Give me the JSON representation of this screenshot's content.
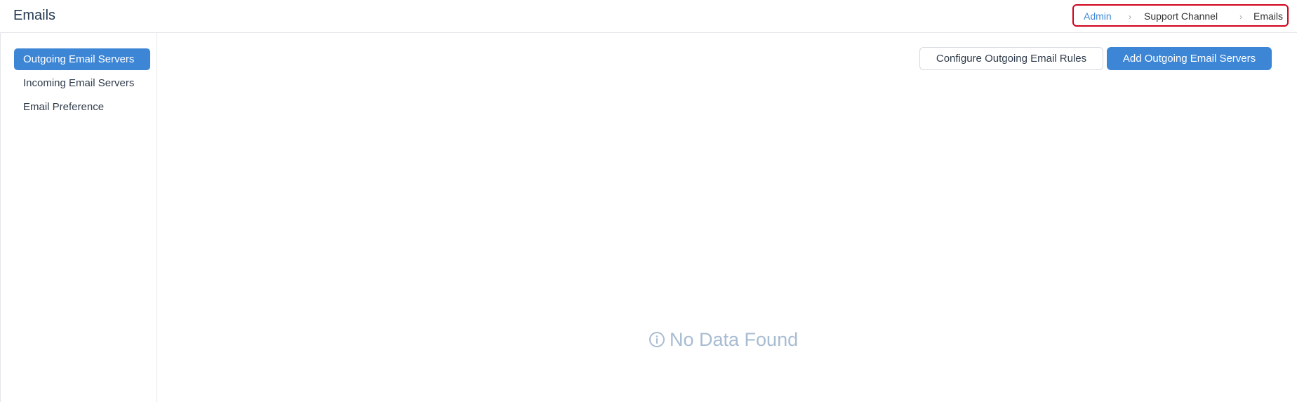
{
  "header": {
    "title": "Emails",
    "breadcrumb": {
      "root": "Admin",
      "middle": "Support Channel",
      "current": "Emails",
      "separator": "›"
    }
  },
  "sidebar": {
    "items": [
      {
        "label": "Outgoing Email Servers",
        "active": true
      },
      {
        "label": "Incoming Email Servers",
        "active": false
      },
      {
        "label": "Email Preference",
        "active": false
      }
    ]
  },
  "toolbar": {
    "configure_label": "Configure Outgoing Email Rules",
    "add_label": "Add Outgoing Email Servers"
  },
  "main": {
    "empty_message": "No Data Found",
    "empty_icon": "info-circle-icon"
  },
  "colors": {
    "accent": "#3d86d6",
    "breadcrumb_highlight": "#d0021b",
    "empty_text": "#a8bcd2"
  }
}
